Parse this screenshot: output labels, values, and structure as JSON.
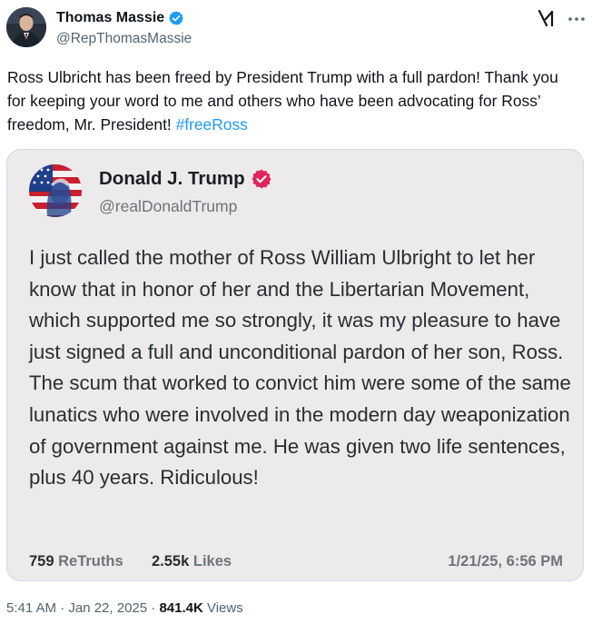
{
  "author": {
    "name": "Thomas Massie",
    "handle": "@RepThomasMassie",
    "verified_color": "#1d9bf0"
  },
  "icons": {
    "grok": "grok-icon",
    "more": "more-icon"
  },
  "tweet": {
    "text_main": "Ross Ulbricht has been freed by President Trump with a full pardon! Thank you for keeping your word to me and others who have been advocating for Ross’ freedom, Mr. President! ",
    "hashtag": "#freeRoss"
  },
  "quoted": {
    "name": "Donald J. Trump",
    "handle": "@realDonaldTrump",
    "verified_color": "#e0245e",
    "text": "I just called the mother of Ross William Ulbright to let her know that in honor of her and the Libertarian Movement, which supported me so strongly, it was my pleasure to have just signed a full and unconditional pardon of her son, Ross. The scum that worked to convict him were some of the same lunatics who were involved in the modern day weaponization of government against me. He was given two life sentences, plus 40 years. Ridiculous!",
    "retruths_count": "759",
    "retruths_label": "ReTruths",
    "likes_count": "2.55k",
    "likes_label": "Likes",
    "date": "1/21/25, 6:56 PM"
  },
  "meta": {
    "time": "5:41 AM · Jan 22, 2025 · ",
    "views_count": "841.4K",
    "views_label": " Views"
  }
}
